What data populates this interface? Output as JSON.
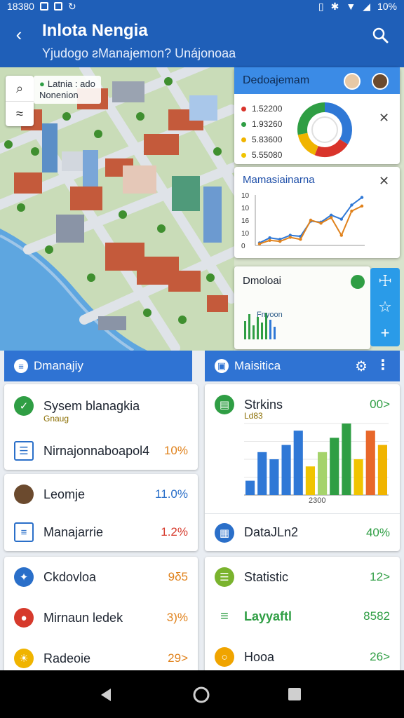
{
  "status_bar": {
    "time": "18380",
    "battery": "10%"
  },
  "app_bar": {
    "title": "Inlota Nengia",
    "subtitle": "Yjudogo ƨManajemon? Unájonoaa"
  },
  "map": {
    "chip_line1": "Latnia : ado",
    "chip_line2": "Nonenion"
  },
  "panel_donut": {
    "title": "Dedoajemam",
    "legend": [
      {
        "label": "1.52200",
        "color": "#d9342b"
      },
      {
        "label": "1.93260",
        "color": "#2f9e44"
      },
      {
        "label": "5.83600",
        "color": "#f0b400"
      },
      {
        "label": "5.55080",
        "color": "#f0c400"
      }
    ],
    "chart_data": {
      "type": "pie",
      "values": [
        34,
        22,
        16,
        28
      ],
      "colors": [
        "#2f78d6",
        "#d9342b",
        "#f0b400",
        "#2f9e44"
      ]
    }
  },
  "panel_line": {
    "title": "Mamasiainarna",
    "y_ticks": [
      "10",
      "10",
      "16",
      "10",
      "0"
    ],
    "chart_data": {
      "type": "line",
      "ylim": [
        0,
        10
      ],
      "series": [
        {
          "color": "#2f78d6",
          "values": [
            0.5,
            1.5,
            1.2,
            2.0,
            1.8,
            4.8,
            4.6,
            6.0,
            5.2,
            8.0,
            9.5
          ]
        },
        {
          "color": "#e0821c",
          "values": [
            0.3,
            1.0,
            0.8,
            1.6,
            1.2,
            5.0,
            4.4,
            5.5,
            2.0,
            6.8,
            7.8
          ]
        }
      ]
    }
  },
  "panel_mini": {
    "title": "Dmoloai",
    "bar_caption": "Fnyoon"
  },
  "section_left": {
    "title": "Dmanajiy"
  },
  "section_right": {
    "title": "Maisitica"
  },
  "left_cards": [
    {
      "label": "Sysem blanagkia",
      "sub": "Gnaug",
      "color": "#2f9e44"
    },
    {
      "label": "Nirnajonnaboapol4",
      "value": "10%"
    },
    {
      "label": "Leomje",
      "value": "11.0%"
    },
    {
      "label": "Manajarrie",
      "value": "1.2%"
    },
    {
      "label": "Ckdovloa",
      "value": "9δ5"
    },
    {
      "label": "Mirnaun ledek",
      "value": "3)%"
    },
    {
      "label": "Radeoie",
      "value": "29>"
    }
  ],
  "right_cards": {
    "stats": {
      "label": "Strkins",
      "sub": "Ld83",
      "value": "00>"
    },
    "bar_chart": {
      "xlabel": "2300",
      "chart_data": {
        "type": "bar",
        "values": [
          2,
          6,
          5,
          7,
          9,
          4,
          6,
          8,
          10,
          5,
          9,
          7
        ],
        "colors": [
          "#2f78d6",
          "#2f78d6",
          "#2f78d6",
          "#2f78d6",
          "#2f78d6",
          "#f0c400",
          "#a5d36b",
          "#2f9e44",
          "#2f9e44",
          "#f0c400",
          "#e8672a",
          "#f0b400"
        ],
        "ylim": [
          0,
          10
        ]
      }
    },
    "datalin": {
      "label": "DataJLn2",
      "value": "40%"
    },
    "statistic": {
      "label": "Statistic",
      "value": "12>"
    },
    "layout": {
      "label": "Layyaftl",
      "value": "8582"
    },
    "hooa": {
      "label": "Hooa",
      "value": "26>"
    }
  }
}
